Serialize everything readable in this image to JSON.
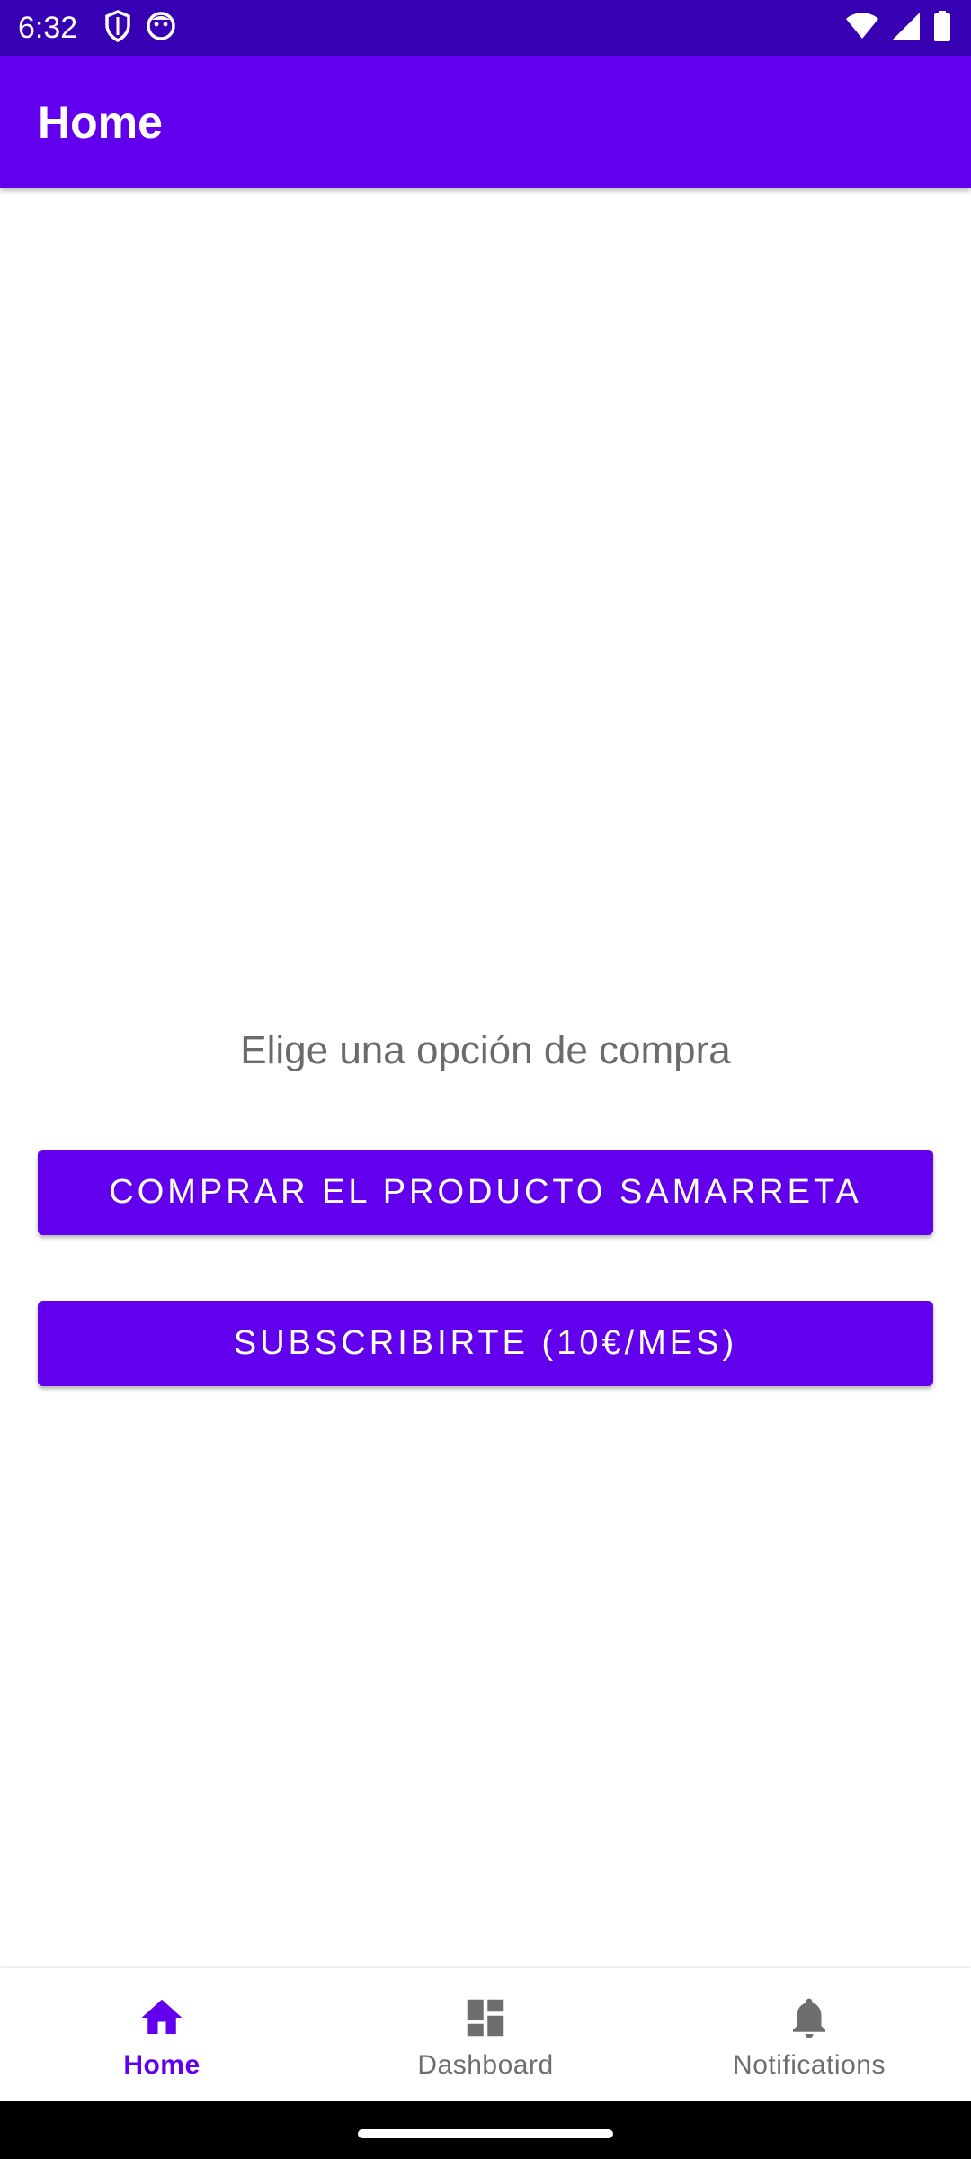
{
  "status_bar": {
    "time": "6:32",
    "left_icons": [
      "shield-icon",
      "face-icon"
    ],
    "right_icons": [
      "wifi-icon",
      "signal-icon",
      "battery-icon"
    ],
    "background": "#3700B3"
  },
  "app_bar": {
    "title": "Home",
    "background": "#6200EE"
  },
  "main": {
    "prompt": "Elige una opción de compra",
    "buttons": {
      "product": "COMPRAR EL PRODUCTO SAMARRETA",
      "subscribe": "SUBSCRIBIRTE (10€/MES)"
    },
    "button_color": "#6200EE"
  },
  "bottom_nav": {
    "items": [
      {
        "label": "Home",
        "icon": "home-icon",
        "active": true
      },
      {
        "label": "Dashboard",
        "icon": "dashboard-icon",
        "active": false
      },
      {
        "label": "Notifications",
        "icon": "bell-icon",
        "active": false
      }
    ],
    "active_color": "#6200EE",
    "inactive_color": "#6e6e6e"
  }
}
